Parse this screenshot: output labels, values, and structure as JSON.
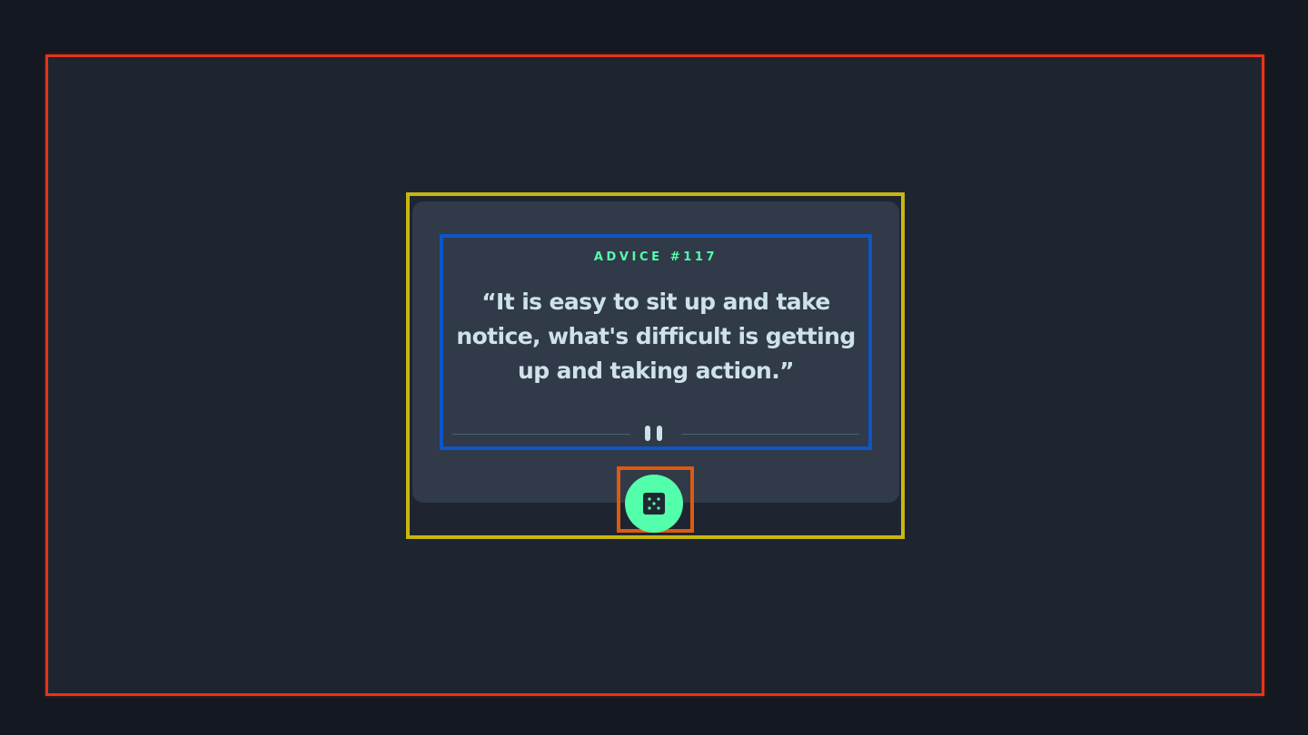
{
  "advice": {
    "heading": "ADVICE #117",
    "quote": "“It is easy to sit up and take notice, what's difficult is getting up and taking action.”"
  },
  "divider": {
    "icon": "pause-icon"
  },
  "dice_button": {
    "icon": "dice-icon"
  },
  "colors": {
    "accent": "#53ffab",
    "text": "#cee3e9",
    "card_bg": "#313a48",
    "page_bg": "#1f2530"
  }
}
